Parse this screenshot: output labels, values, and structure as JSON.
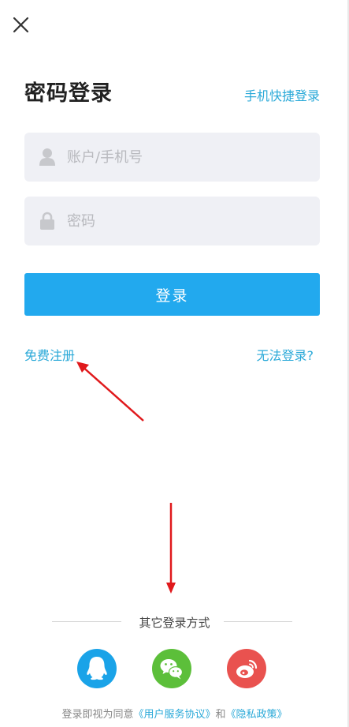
{
  "header": {
    "title": "密码登录",
    "quick_login_link": "手机快捷登录"
  },
  "form": {
    "account_placeholder": "账户/手机号",
    "password_placeholder": "密码",
    "login_button": "登录"
  },
  "links": {
    "register": "免费注册",
    "cannot_login": "无法登录?"
  },
  "other_login": {
    "label": "其它登录方式",
    "methods": [
      "qq",
      "wechat",
      "weibo"
    ]
  },
  "agreement": {
    "prefix": "登录即视为同意",
    "user_agreement": "《用户服务协议》",
    "and": "和",
    "privacy_policy": "《隐私政策》"
  },
  "colors": {
    "accent": "#2aa9d8",
    "login_button": "#22a9ee",
    "qq": "#1aa3e8",
    "wechat": "#5cbf3a",
    "weibo": "#e9524f",
    "annotation_arrow": "#e0191c"
  },
  "icons": [
    "close-icon",
    "user-icon",
    "lock-icon",
    "qq-icon",
    "wechat-icon",
    "weibo-icon"
  ]
}
